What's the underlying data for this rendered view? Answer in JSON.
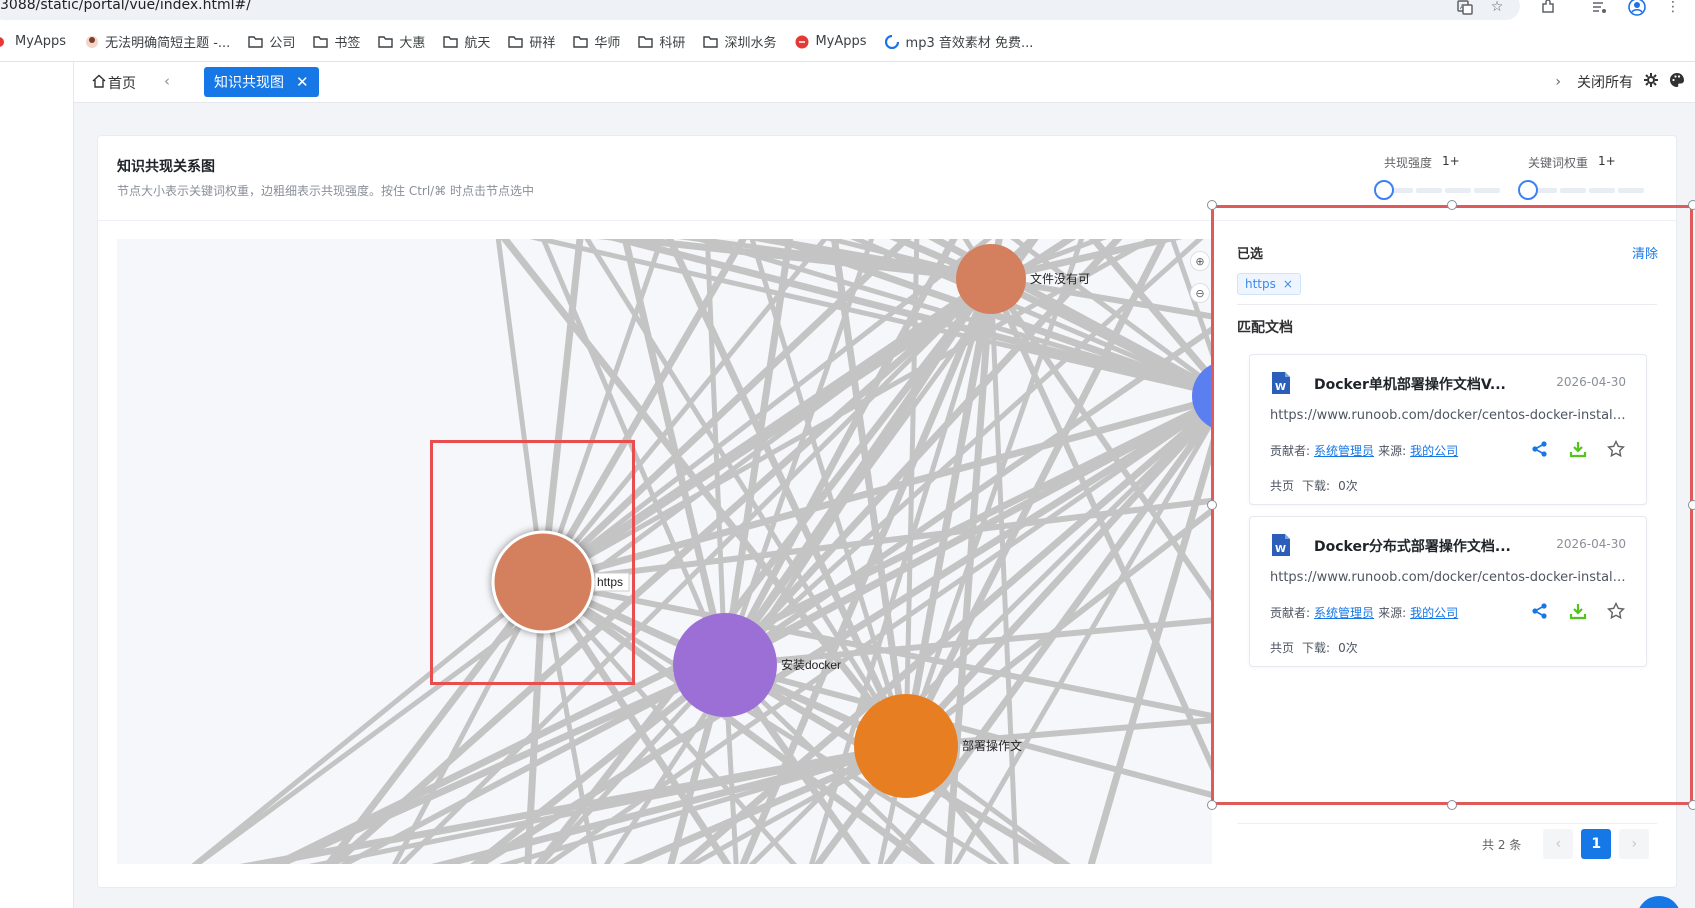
{
  "browser": {
    "url": "3088/static/portal/vue/index.html#/",
    "bookmarks": [
      {
        "label": "MyApps",
        "icon": "red-dot-icon"
      },
      {
        "label": "无法明确简短主题 -...",
        "icon": "avatar-icon"
      },
      {
        "label": "公司",
        "icon": "folder-icon"
      },
      {
        "label": "书签",
        "icon": "folder-icon"
      },
      {
        "label": "大惠",
        "icon": "folder-icon"
      },
      {
        "label": "航天",
        "icon": "folder-icon"
      },
      {
        "label": "研祥",
        "icon": "folder-icon"
      },
      {
        "label": "华师",
        "icon": "folder-icon"
      },
      {
        "label": "科研",
        "icon": "folder-icon"
      },
      {
        "label": "深圳水务",
        "icon": "folder-icon"
      },
      {
        "label": "MyApps",
        "icon": "red-app-icon"
      },
      {
        "label": "mp3 音效素材 免费...",
        "icon": "blue-ring-icon"
      }
    ]
  },
  "tabs": {
    "home_label": "首页",
    "active_label": "知识共现图",
    "close_all_label": "关闭所有"
  },
  "card": {
    "title": "知识共现关系图",
    "subtitle": "节点大小表示关键词权重，边粗细表示共现强度。按住 Ctrl/⌘ 时点击节点选中",
    "slider_cooccur": {
      "label": "共现强度",
      "value": "1+"
    },
    "slider_weight": {
      "label": "关键词权重",
      "value": "1+"
    }
  },
  "graph": {
    "nodes": [
      {
        "id": "https",
        "label": "https",
        "color": "#d4805f",
        "selected": true
      },
      {
        "id": "install_docker",
        "label": "安装docker",
        "color": "#9b6fd6"
      },
      {
        "id": "deploy_doc",
        "label": "部署操作文",
        "color": "#e87e22"
      },
      {
        "id": "file_none",
        "label": "文件没有可",
        "color": "#d4805f"
      },
      {
        "id": "blue_node",
        "label": "",
        "color": "#5b7ef0"
      }
    ],
    "edge_color": "#c4c4c4"
  },
  "panel": {
    "selected_label": "已选",
    "clear_label": "清除",
    "chip_label": "https",
    "docs_label": "匹配文档",
    "docs": [
      {
        "title": "Docker单机部署操作文档V...",
        "date": "2026-04-30",
        "url": "https://www.runoob.com/docker/centos-docker-install...",
        "contributor_label": "贡献者:",
        "contributor": "系统管理员",
        "source_label": "来源:",
        "source": "我的公司",
        "pages_label": "共页",
        "downloads_label": "下载:",
        "downloads": "0次"
      },
      {
        "title": "Docker分布式部署操作文档...",
        "date": "2026-04-30",
        "url": "https://www.runoob.com/docker/centos-docker-install...",
        "contributor_label": "贡献者:",
        "contributor": "系统管理员",
        "source_label": "来源:",
        "source": "我的公司",
        "pages_label": "共页",
        "downloads_label": "下载:",
        "downloads": "0次"
      }
    ],
    "pagination": {
      "total": "共 2 条",
      "current": "1",
      "prev": "‹",
      "next": "›"
    }
  },
  "colors": {
    "accent": "#1677e6",
    "highlight": "#ea4d4d",
    "download": "#52c41a"
  }
}
